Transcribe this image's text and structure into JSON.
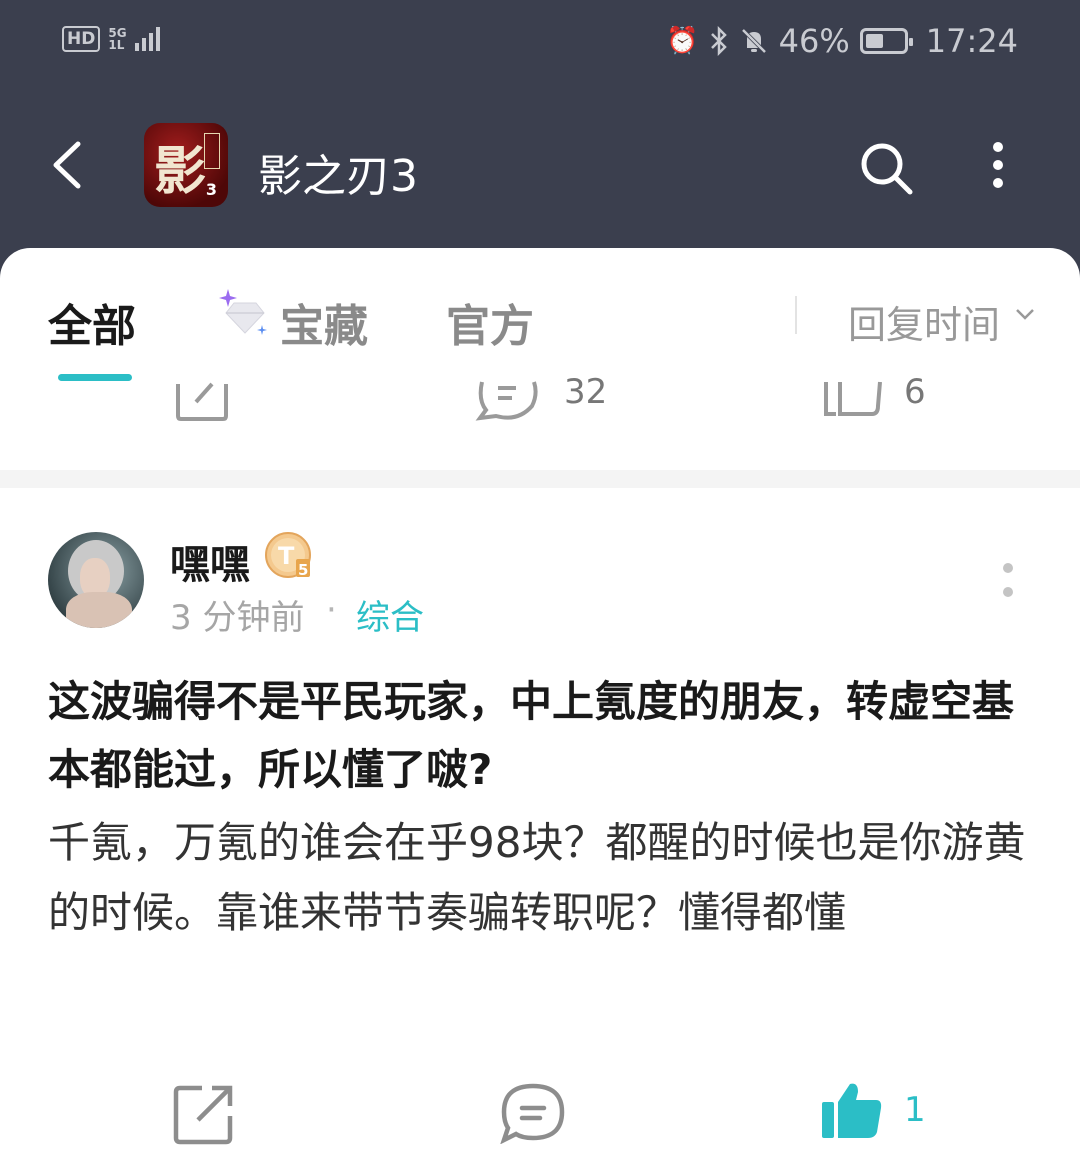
{
  "status_bar": {
    "network_hd": "HD",
    "network_5g": "5G",
    "network_sub": "1L",
    "battery_percent": "46%",
    "battery_level": 0.46,
    "time": "17:24"
  },
  "header": {
    "app_title": "影之刃3",
    "app_icon_glyph": "影",
    "app_icon_number": "3"
  },
  "tabs": [
    {
      "label": "全部",
      "active": true
    },
    {
      "label": "宝藏",
      "active": false
    },
    {
      "label": "官方",
      "active": false
    }
  ],
  "sort": {
    "label": "回复时间"
  },
  "previous_post": {
    "comment_count": "32",
    "like_count": "6"
  },
  "post": {
    "username": "嘿嘿",
    "level_badge": "T5",
    "time": "3 分钟前",
    "separator": "·",
    "category": "综合",
    "title": "这波骗得不是平民玩家，中上氪度的朋友，转虚空基本都能过，所以懂了啵?",
    "body": "千氪，万氪的谁会在乎98块？都醒的时候也是你游黄的时候。靠谁来带节奏骗转职呢？懂得都懂",
    "like_count": "1"
  },
  "colors": {
    "header_bg": "#3b3f4e",
    "accent": "#2bbec6"
  }
}
